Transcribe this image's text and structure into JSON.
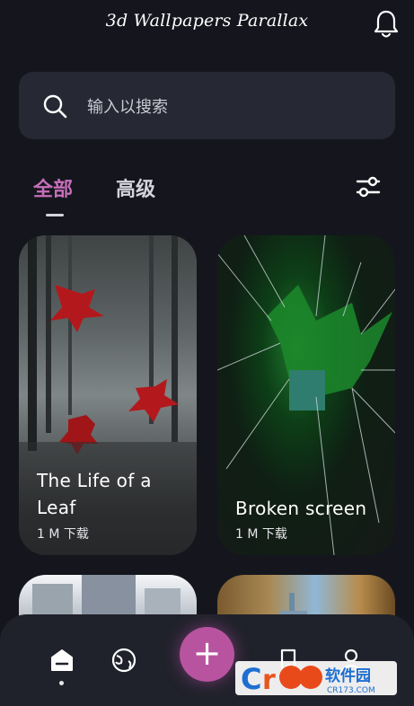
{
  "header": {
    "title": "3d Wallpapers Parallax"
  },
  "search": {
    "placeholder": "输入以搜索"
  },
  "tabs": [
    {
      "label": "全部",
      "active": true
    },
    {
      "label": "高级",
      "active": false
    }
  ],
  "cards": [
    {
      "title": "The Life of a Leaf",
      "downloads": "1 M 下载"
    },
    {
      "title": "Broken screen",
      "downloads": "1 M 下载"
    }
  ],
  "colors": {
    "background": "#15161d",
    "surface": "#262833",
    "accent": "#c76fba",
    "fab": "#b8549f"
  },
  "watermark": {
    "text": "西西软件园",
    "url": "CR173.COM"
  }
}
